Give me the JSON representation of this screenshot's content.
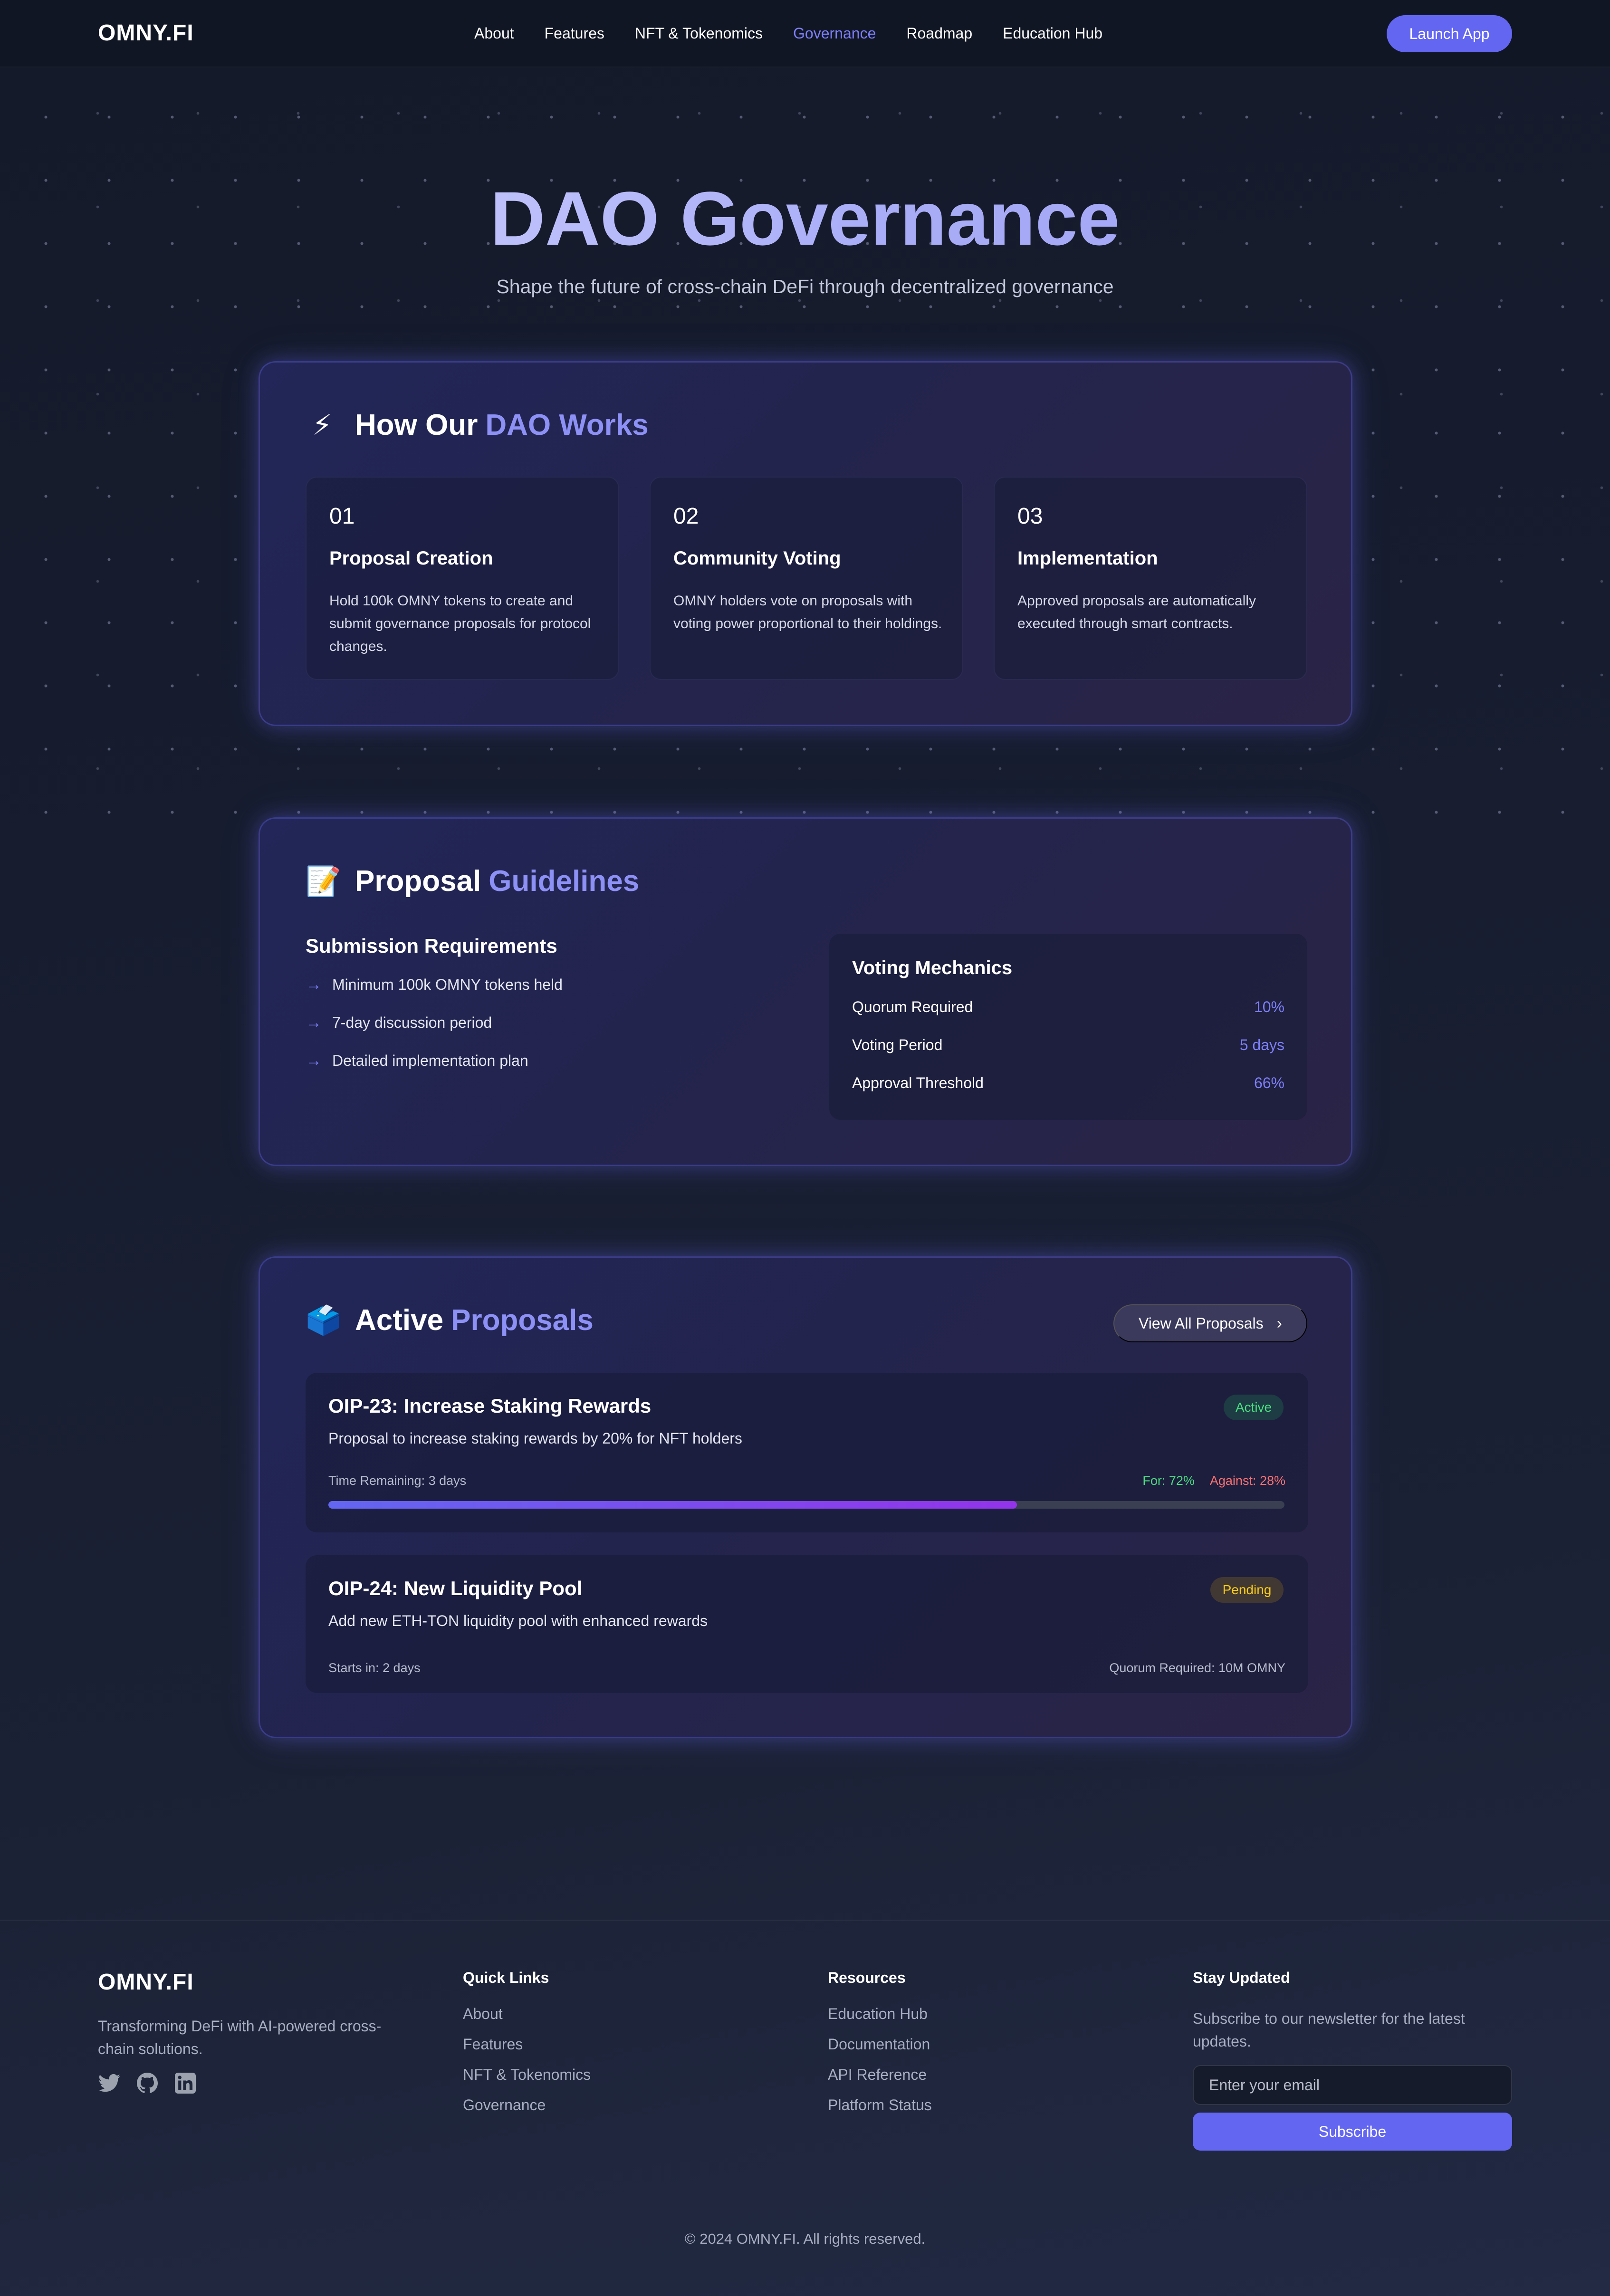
{
  "nav": {
    "logo": "OMNY.FI",
    "links": [
      "About",
      "Features",
      "NFT & Tokenomics",
      "Governance",
      "Roadmap",
      "Education Hub"
    ],
    "active_link": "Governance",
    "launch_label": "Launch App"
  },
  "hero": {
    "title": "DAO Governance",
    "subtitle": "Shape the future of cross-chain DeFi through decentralized governance"
  },
  "how": {
    "emoji": "⚡",
    "title_plain": "How Our",
    "title_accent": "DAO Works",
    "steps": [
      {
        "num": "01",
        "title": "Proposal Creation",
        "desc": "Hold 100k OMNY tokens to create and submit governance proposals for protocol changes."
      },
      {
        "num": "02",
        "title": "Community Voting",
        "desc": "OMNY holders vote on proposals with voting power proportional to their holdings."
      },
      {
        "num": "03",
        "title": "Implementation",
        "desc": "Approved proposals are automatically executed through smart contracts."
      }
    ]
  },
  "guidelines": {
    "emoji": "📝",
    "title_plain": "Proposal",
    "title_accent": "Guidelines",
    "requirements_title": "Submission Requirements",
    "arrow": "→",
    "requirements": [
      "Minimum 100k OMNY tokens held",
      "7-day discussion period",
      "Detailed implementation plan"
    ],
    "mechanics_title": "Voting Mechanics",
    "mechanics": [
      {
        "label": "Quorum Required",
        "value": "10%"
      },
      {
        "label": "Voting Period",
        "value": "5 days"
      },
      {
        "label": "Approval Threshold",
        "value": "66%"
      }
    ]
  },
  "proposals": {
    "emoji": "🗳️",
    "title_plain": "Active",
    "title_accent": "Proposals",
    "view_all_label": "View All Proposals",
    "view_all_chevron": "›",
    "items": [
      {
        "title": "OIP-23: Increase Staking Rewards",
        "status": "Active",
        "desc": "Proposal to increase staking rewards by 20% for NFT holders",
        "meta": "Time Remaining: 3 days",
        "for": "For: 72%",
        "against": "Against: 28%",
        "for_fraction": 0.72
      },
      {
        "title": "OIP-24: New Liquidity Pool",
        "status": "Pending",
        "desc": "Add new ETH-TON liquidity pool with enhanced rewards",
        "meta": "Starts in: 2 days",
        "quorum": "Quorum Required: 10M OMNY"
      }
    ]
  },
  "footer": {
    "logo": "OMNY.FI",
    "tagline": "Transforming DeFi with AI-powered cross-chain solutions.",
    "socials": [
      "twitter-icon",
      "github-icon",
      "linkedin-icon"
    ],
    "quick_links_title": "Quick Links",
    "quick_links": [
      "About",
      "Features",
      "NFT & Tokenomics",
      "Governance"
    ],
    "resources_title": "Resources",
    "resources": [
      "Education Hub",
      "Documentation",
      "API Reference",
      "Platform Status"
    ],
    "newsletter_title": "Stay Updated",
    "newsletter_text": "Subscribe to our newsletter for the latest updates.",
    "email_placeholder": "Enter your email",
    "subscribe_label": "Subscribe",
    "copyright": "© 2024 OMNY.FI. All rights reserved."
  },
  "colors": {
    "accent": "#6366f1",
    "accent_text": "#7c7ff8",
    "active_green": "#4ade80",
    "pending_yellow": "#facc15",
    "against_red": "#f87171"
  }
}
